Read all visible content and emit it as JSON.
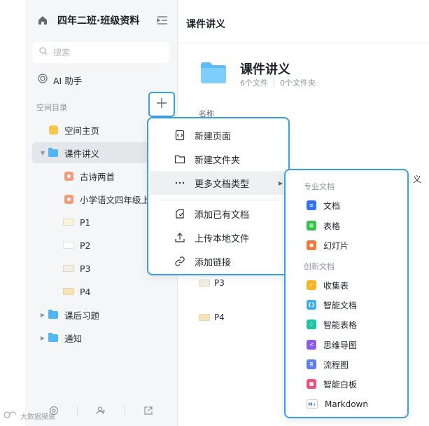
{
  "sidebar": {
    "title": "四年二班·班级资料",
    "search_placeholder": "搜索",
    "ai_label": "AI 助手",
    "section_label": "空间目录",
    "items": [
      {
        "label": "空间主页",
        "icon": "home-page-icon"
      },
      {
        "label": "课件讲义",
        "icon": "folder-icon",
        "expanded": true,
        "selected": true
      },
      {
        "label": "古诗两首",
        "icon": "document-icon"
      },
      {
        "label": "小学语文四年级上",
        "icon": "document-icon"
      },
      {
        "label": "P1",
        "icon": "image-icon"
      },
      {
        "label": "P2",
        "icon": "image-icon"
      },
      {
        "label": "P3",
        "icon": "image-icon"
      },
      {
        "label": "P4",
        "icon": "image-icon"
      },
      {
        "label": "课后习题",
        "icon": "folder-icon",
        "expanded": false
      },
      {
        "label": "通知",
        "icon": "folder-icon",
        "expanded": false
      }
    ]
  },
  "main": {
    "header_title": "课件讲义",
    "folder_name": "课件讲义",
    "file_count": "6个文件",
    "folder_count": "0个文件夹",
    "column_name": "名称",
    "rows": [
      {
        "label": "P3"
      },
      {
        "label": "P4"
      }
    ],
    "right_fragment": "义"
  },
  "menu": {
    "items": [
      {
        "label": "新建页面",
        "icon": "new-page-icon"
      },
      {
        "label": "新建文件夹",
        "icon": "folder-outline-icon"
      },
      {
        "label": "更多文档类型",
        "icon": "more-dots-icon",
        "has_submenu": true
      },
      {
        "label": "添加已有文档",
        "icon": "add-existing-icon"
      },
      {
        "label": "上传本地文件",
        "icon": "upload-icon"
      },
      {
        "label": "添加链接",
        "icon": "link-icon"
      }
    ]
  },
  "submenu": {
    "group1": "专业文档",
    "group2": "创新文档",
    "items": [
      {
        "label": "文档",
        "color": "#3370ff"
      },
      {
        "label": "表格",
        "color": "#34c24b"
      },
      {
        "label": "幻灯片",
        "color": "#f07a3c"
      },
      {
        "label": "收集表",
        "color": "#f5b623"
      },
      {
        "label": "智能文档",
        "color": "#3ab0f0"
      },
      {
        "label": "智能表格",
        "color": "#1fc3a3"
      },
      {
        "label": "思维导图",
        "color": "#8a5cf0"
      },
      {
        "label": "流程图",
        "color": "#5a7cf5"
      },
      {
        "label": "智能白板",
        "color": "#f0507a"
      },
      {
        "label": "Markdown",
        "color": "#3370ff",
        "badge": "M↓"
      }
    ]
  },
  "watermark": "大数据摸鱼"
}
